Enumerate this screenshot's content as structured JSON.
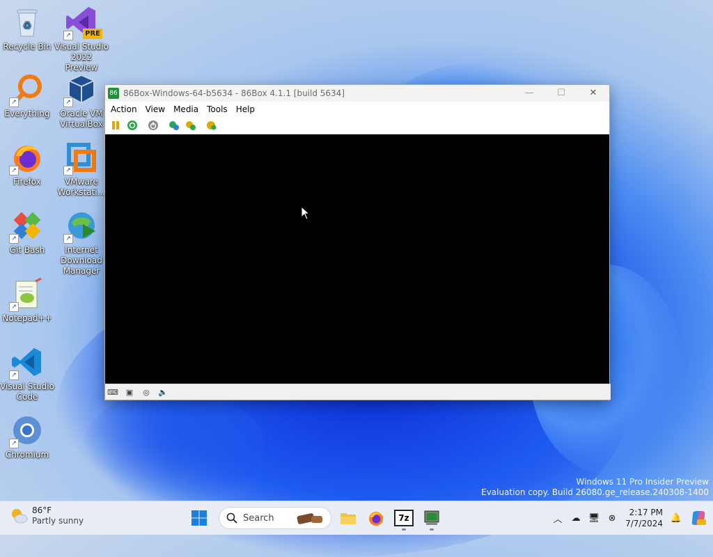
{
  "desktop": {
    "icons": [
      {
        "label": "Recycle Bin",
        "icon": "recycle-bin-icon"
      },
      {
        "label": "Visual Studio 2022 Preview",
        "icon": "visual-studio-icon",
        "badge": "PRE"
      },
      {
        "label": "Everything",
        "icon": "everything-search-icon"
      },
      {
        "label": "Oracle VM VirtualBox",
        "icon": "virtualbox-icon"
      },
      {
        "label": "Firefox",
        "icon": "firefox-icon"
      },
      {
        "label": "VMware Workstati...",
        "icon": "vmware-icon"
      },
      {
        "label": "Git Bash",
        "icon": "git-bash-icon"
      },
      {
        "label": "Internet Download Manager",
        "icon": "idm-icon"
      },
      {
        "label": "Notepad++",
        "icon": "notepadpp-icon"
      },
      {
        "label": "Visual Studio Code",
        "icon": "vscode-icon"
      },
      {
        "label": "Chromium",
        "icon": "chromium-icon"
      }
    ]
  },
  "window": {
    "title": "86Box-Windows-64-b5634 - 86Box 4.1.1 [build 5634]",
    "app_icon_text": "86",
    "menu": [
      "Action",
      "View",
      "Media",
      "Tools",
      "Help"
    ],
    "toolbar": [
      "pause-icon",
      "reset-icon",
      "power-icon",
      "settings-icon",
      "cad-icon",
      "hard-reset-icon"
    ],
    "statusbar": [
      "keyboard-icon",
      "floppy-icon",
      "cdrom-icon",
      "sound-icon"
    ]
  },
  "watermark": {
    "line1": "Windows 11 Pro Insider Preview",
    "line2": "Evaluation copy. Build 26080.ge_release.240308-1400"
  },
  "taskbar": {
    "weather_temp": "86°F",
    "weather_desc": "Partly sunny",
    "search_placeholder": "Search",
    "seven_zip_label": "7z",
    "time": "2:17 PM",
    "date": "7/7/2024",
    "colors": {
      "accent": "#0067c0",
      "taskbar_bg": "#e9eef6"
    }
  }
}
